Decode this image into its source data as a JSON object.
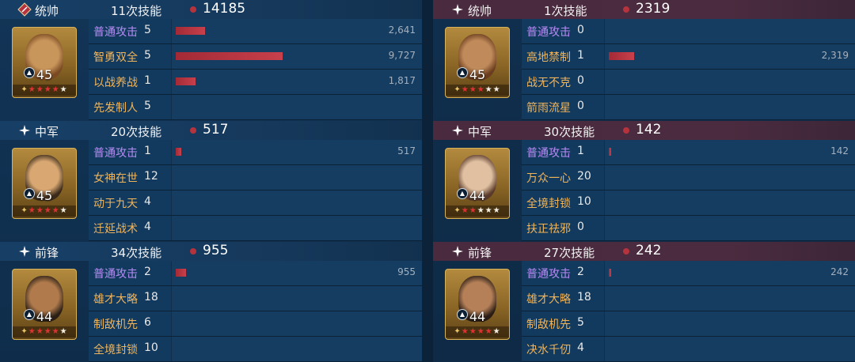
{
  "colors": {
    "bar": "#c03a45",
    "basic_skill": "#b88cf5",
    "skill": "#f0b45a",
    "left_header": "#173f66",
    "right_header": "#4a2a3e"
  },
  "max_damage": 9727,
  "sides": [
    {
      "side": "left",
      "blocks": [
        {
          "role": "统帅",
          "role_icon": "banner-icon",
          "casts": "11次技能",
          "total": "14185",
          "level": "45",
          "stars_red": 4,
          "stars_white": 1,
          "skills": [
            {
              "name": "普通攻击",
              "count": "5",
              "damage": 2641,
              "damage_label": "2,641",
              "basic": true
            },
            {
              "name": "智勇双全",
              "count": "5",
              "damage": 9727,
              "damage_label": "9,727",
              "basic": false
            },
            {
              "name": "以战养战",
              "count": "1",
              "damage": 1817,
              "damage_label": "1,817",
              "basic": false
            },
            {
              "name": "先发制人",
              "count": "5",
              "damage": 0,
              "damage_label": "",
              "basic": false
            }
          ]
        },
        {
          "role": "中军",
          "role_icon": "sparkle-icon",
          "casts": "20次技能",
          "total": "517",
          "level": "45",
          "stars_red": 4,
          "stars_white": 1,
          "skills": [
            {
              "name": "普通攻击",
              "count": "1",
              "damage": 517,
              "damage_label": "517",
              "basic": true
            },
            {
              "name": "女神在世",
              "count": "12",
              "damage": 0,
              "damage_label": "",
              "basic": false
            },
            {
              "name": "动于九天",
              "count": "4",
              "damage": 0,
              "damage_label": "",
              "basic": false
            },
            {
              "name": "迁延战术",
              "count": "4",
              "damage": 0,
              "damage_label": "",
              "basic": false
            }
          ]
        },
        {
          "role": "前锋",
          "role_icon": "sparkle-icon",
          "casts": "34次技能",
          "total": "955",
          "level": "44",
          "stars_red": 4,
          "stars_white": 1,
          "skills": [
            {
              "name": "普通攻击",
              "count": "2",
              "damage": 955,
              "damage_label": "955",
              "basic": true
            },
            {
              "name": "雄才大略",
              "count": "18",
              "damage": 0,
              "damage_label": "",
              "basic": false
            },
            {
              "name": "制敌机先",
              "count": "6",
              "damage": 0,
              "damage_label": "",
              "basic": false
            },
            {
              "name": "全境封锁",
              "count": "10",
              "damage": 0,
              "damage_label": "",
              "basic": false
            }
          ]
        }
      ]
    },
    {
      "side": "right",
      "blocks": [
        {
          "role": "统帅",
          "role_icon": "sparkle-icon",
          "casts": "1次技能",
          "total": "2319",
          "level": "45",
          "stars_red": 3,
          "stars_white": 2,
          "skills": [
            {
              "name": "普通攻击",
              "count": "0",
              "damage": 0,
              "damage_label": "",
              "basic": true
            },
            {
              "name": "高地禁制",
              "count": "1",
              "damage": 2319,
              "damage_label": "2,319",
              "basic": false
            },
            {
              "name": "战无不克",
              "count": "0",
              "damage": 0,
              "damage_label": "",
              "basic": false
            },
            {
              "name": "箭雨流星",
              "count": "0",
              "damage": 0,
              "damage_label": "",
              "basic": false
            }
          ]
        },
        {
          "role": "中军",
          "role_icon": "sparkle-icon",
          "casts": "30次技能",
          "total": "142",
          "level": "44",
          "stars_red": 2,
          "stars_white": 3,
          "skills": [
            {
              "name": "普通攻击",
              "count": "1",
              "damage": 142,
              "damage_label": "142",
              "basic": true
            },
            {
              "name": "万众一心",
              "count": "20",
              "damage": 0,
              "damage_label": "",
              "basic": false
            },
            {
              "name": "全境封锁",
              "count": "10",
              "damage": 0,
              "damage_label": "",
              "basic": false
            },
            {
              "name": "扶正祛邪",
              "count": "0",
              "damage": 0,
              "damage_label": "",
              "basic": false
            }
          ]
        },
        {
          "role": "前锋",
          "role_icon": "sparkle-icon",
          "casts": "27次技能",
          "total": "242",
          "level": "44",
          "stars_red": 4,
          "stars_white": 1,
          "skills": [
            {
              "name": "普通攻击",
              "count": "2",
              "damage": 242,
              "damage_label": "242",
              "basic": true
            },
            {
              "name": "雄才大略",
              "count": "18",
              "damage": 0,
              "damage_label": "",
              "basic": false
            },
            {
              "name": "制敌机先",
              "count": "5",
              "damage": 0,
              "damage_label": "",
              "basic": false
            },
            {
              "name": "决水千仞",
              "count": "4",
              "damage": 0,
              "damage_label": "",
              "basic": false
            }
          ]
        }
      ]
    }
  ]
}
